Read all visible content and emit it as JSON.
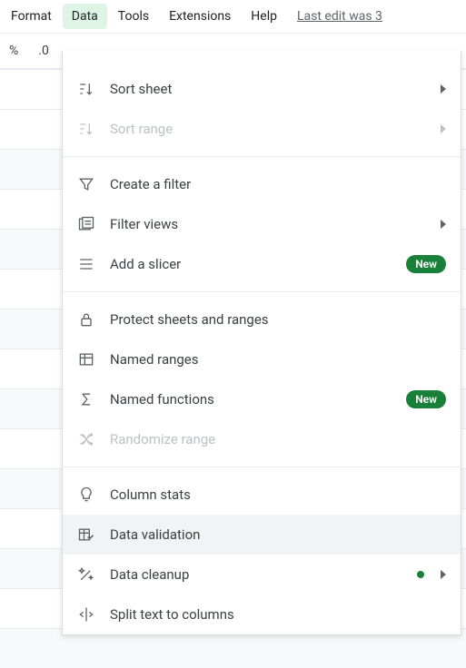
{
  "menubar": {
    "format": "Format",
    "data": "Data",
    "tools": "Tools",
    "extensions": "Extensions",
    "help": "Help",
    "last_edit": "Last edit was 3"
  },
  "toolbar": {
    "percent": "%",
    "decimal_decrease": ".0"
  },
  "badges": {
    "new": "New"
  },
  "dropdown": {
    "sort_sheet": "Sort sheet",
    "sort_range": "Sort range",
    "create_filter": "Create a filter",
    "filter_views": "Filter views",
    "add_slicer": "Add a slicer",
    "protect": "Protect sheets and ranges",
    "named_ranges": "Named ranges",
    "named_functions": "Named functions",
    "randomize_range": "Randomize range",
    "column_stats": "Column stats",
    "data_validation": "Data validation",
    "data_cleanup": "Data cleanup",
    "split_text": "Split text to columns"
  }
}
